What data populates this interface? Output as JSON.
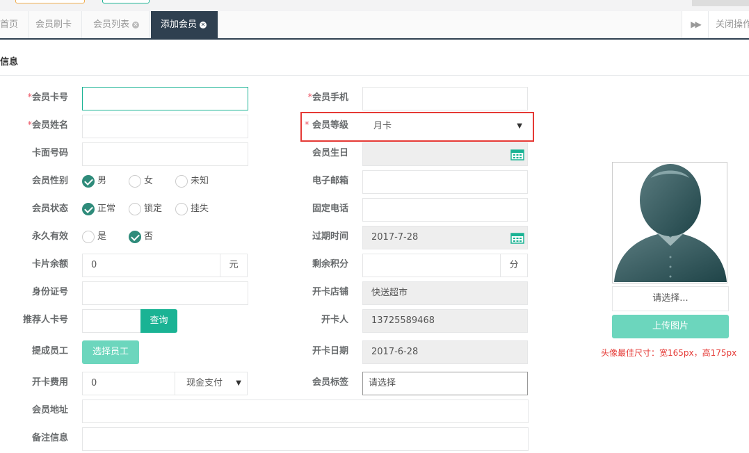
{
  "tabs": [
    {
      "label": "首页"
    },
    {
      "label": "会员刷卡"
    },
    {
      "label": "会员列表"
    },
    {
      "label": "添加会员"
    }
  ],
  "tab_actions": {
    "close_label": "关闭操作"
  },
  "section_title": "信息",
  "form": {
    "card_no": {
      "label": "会员卡号",
      "value": ""
    },
    "name": {
      "label": "会员姓名",
      "value": ""
    },
    "face_no": {
      "label": "卡面号码",
      "value": ""
    },
    "gender": {
      "label": "会员性别",
      "options": [
        "男",
        "女",
        "未知"
      ],
      "selected": "男"
    },
    "status": {
      "label": "会员状态",
      "options": [
        "正常",
        "锁定",
        "挂失"
      ],
      "selected": "正常"
    },
    "permanent": {
      "label": "永久有效",
      "options": [
        "是",
        "否"
      ],
      "selected": "否"
    },
    "balance": {
      "label": "卡片余额",
      "value": "0",
      "unit": "元"
    },
    "id_card": {
      "label": "身份证号",
      "value": ""
    },
    "referrer": {
      "label": "推荐人卡号",
      "value": "",
      "button": "查询"
    },
    "commission": {
      "label": "提成员工",
      "button": "选择员工"
    },
    "fee": {
      "label": "开卡费用",
      "value": "0",
      "pay_method": "现金支付"
    },
    "address": {
      "label": "会员地址",
      "value": ""
    },
    "remark": {
      "label": "备注信息",
      "value": ""
    },
    "phone": {
      "label": "会员手机",
      "value": ""
    },
    "level": {
      "label": "会员等级",
      "value": "月卡"
    },
    "birthday": {
      "label": "会员生日",
      "value": ""
    },
    "email": {
      "label": "电子邮箱",
      "value": ""
    },
    "tel": {
      "label": "固定电话",
      "value": ""
    },
    "expire": {
      "label": "过期时间",
      "value": "2017-7-28"
    },
    "points": {
      "label": "剩余积分",
      "value": "",
      "unit": "分"
    },
    "store": {
      "label": "开卡店铺",
      "value": "快送超市"
    },
    "opener": {
      "label": "开卡人",
      "value": "13725589468"
    },
    "open_date": {
      "label": "开卡日期",
      "value": "2017-6-28"
    },
    "tag": {
      "label": "会员标签",
      "value": "请选择"
    }
  },
  "required_mark": "*",
  "avatar": {
    "choose_label": "请选择...",
    "upload_label": "上传图片",
    "hint": "头像最佳尺寸：宽165px，高175px"
  },
  "colors": {
    "accent": "#1ab394",
    "dark": "#2f4050",
    "required": "#ed5565",
    "highlight": "#e53935"
  }
}
